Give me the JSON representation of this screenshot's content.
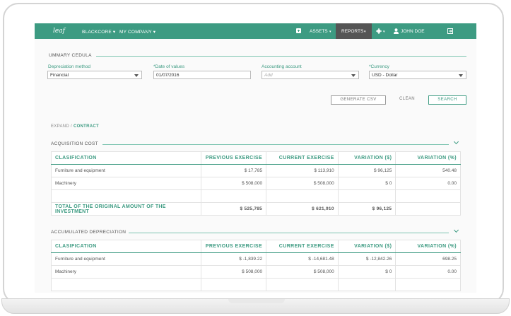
{
  "nav": {
    "logo": "leaf",
    "company1": "BLACKCORE ▾",
    "company2": "MY COMPANY ▾",
    "assets": "ASSETS",
    "assets_caret": "▾",
    "reports": "REPORTS",
    "reports_caret": "▾",
    "settings_caret": "▾",
    "user": "JOHN DOE"
  },
  "summary": {
    "title": "UMMARY CEDULA"
  },
  "filters": {
    "depreciation_label": "Depreciation method",
    "depreciation_value": "Financial",
    "date_label": "*Date of values",
    "date_value": "01/07/2016",
    "account_label": "Accounting account",
    "account_placeholder": "Add",
    "currency_label": "*Currency",
    "currency_value": "USD - Dollar"
  },
  "actions": {
    "generate_csv": "GENERATE CSV",
    "clean": "CLEAN",
    "search": "SEARCH"
  },
  "toggle": {
    "expand": "EXPAND",
    "sep": " / ",
    "contract": "CONTRACT"
  },
  "acquisition": {
    "title": "ACQUISITION COST",
    "headers": [
      "CLASIFICATION",
      "PREVIOUS EXERCISE",
      "CURRENT EXERCISE",
      "VARIATION ($)",
      "VARIATION (%)"
    ],
    "rows": [
      [
        "Furniture and equipment",
        "$ 17,785",
        "$ 113,910",
        "$ 96,125",
        "540.48"
      ],
      [
        "Machinery",
        "$ 508,000",
        "$ 508,000",
        "$ 0",
        "0.00"
      ]
    ],
    "total": [
      "TOTAL OF THE ORIGINAL AMOUNT OF THE INVESTMENT",
      "$ 525,785",
      "$ 621,910",
      "$ 96,125",
      ""
    ]
  },
  "depreciation": {
    "title": "ACCUMULATED DEPRECIATION",
    "headers": [
      "CLASIFICATION",
      "PREVIOUS EXERCISE",
      "CURRENT EXERCISE",
      "VARIATION ($)",
      "VARIATION (%)"
    ],
    "rows": [
      [
        "Furniture and equipment",
        "$ -1,839.22",
        "$ -14,681.48",
        "$ -12,842.26",
        "698.25"
      ],
      [
        "Machinery",
        "$ 508,000",
        "$ 508,000",
        "$ 0",
        "0.00"
      ]
    ]
  },
  "colors": {
    "accent": "#3d9b82",
    "nav_active": "#555555"
  }
}
